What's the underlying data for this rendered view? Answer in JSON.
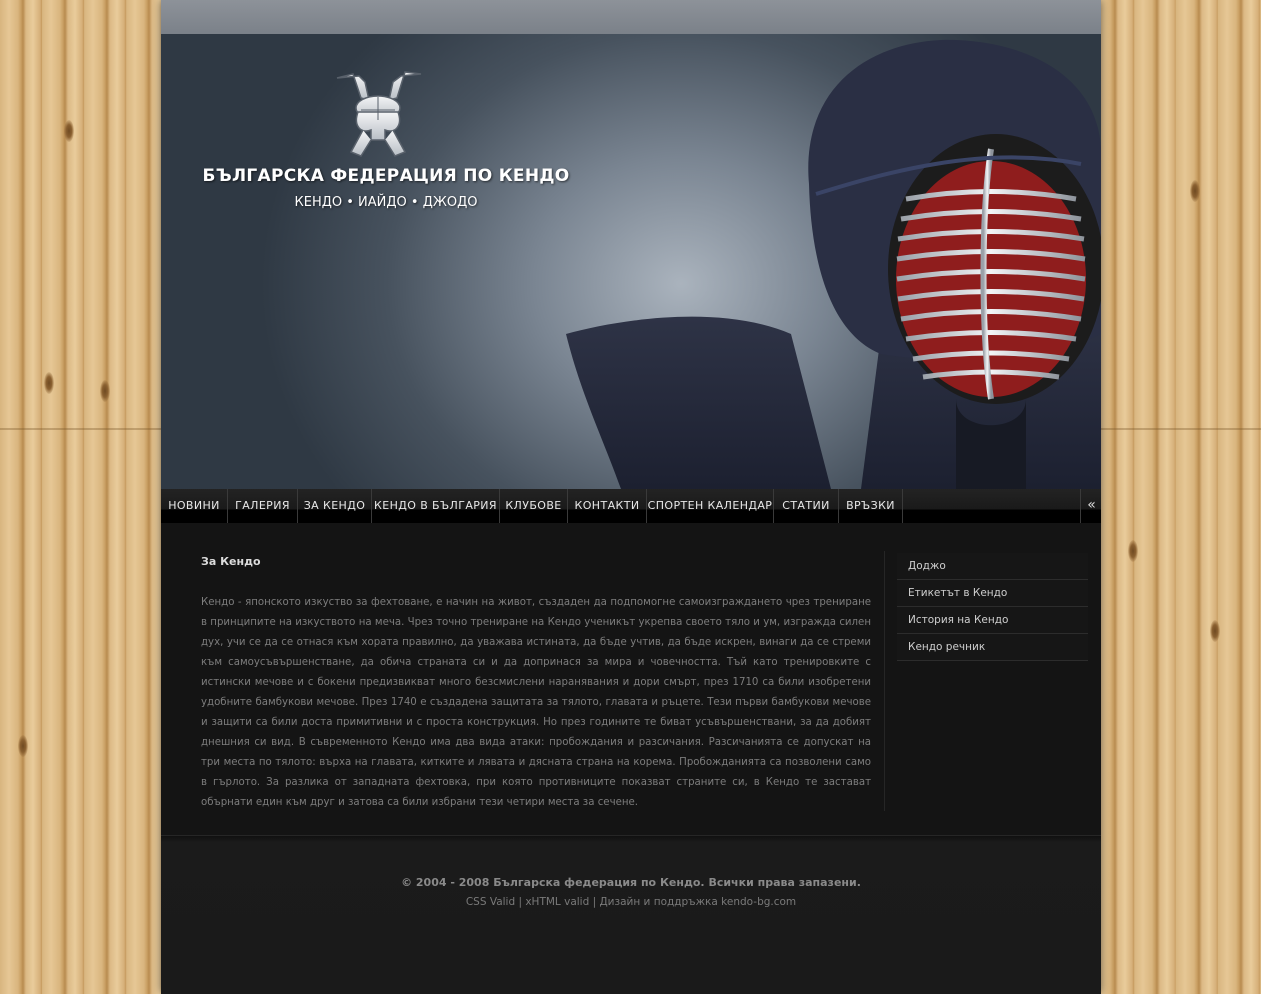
{
  "site": {
    "title": "БЪЛГАРСКА ФЕДЕРАЦИЯ ПО КЕНДО",
    "subtitle": "КЕНДО • ИАЙДО • ДЖОДО"
  },
  "nav": {
    "items": [
      {
        "label": "НОВИНИ"
      },
      {
        "label": "ГАЛЕРИЯ"
      },
      {
        "label": "ЗА КЕНДО"
      },
      {
        "label": "КЕНДО В БЪЛГАРИЯ"
      },
      {
        "label": "КЛУБОВЕ"
      },
      {
        "label": "КОНТАКТИ"
      },
      {
        "label": "СПОРТЕН КАЛЕНДАР"
      },
      {
        "label": "СТАТИИ"
      },
      {
        "label": "ВРЪЗКИ"
      }
    ],
    "collapse_icon": "«"
  },
  "article": {
    "title": "За Кендо",
    "body": "Кендо - японското изкуство за фехтоване, е начин на живот, създаден да подпомогне самоизграждането чрез трениране в принципите на изкуството на меча. Чрез точно трениране на Кендо ученикът укрепва своето тяло и ум, изгражда силен дух, учи се да се отнася към хората правилно, да уважава истината, да бъде учтив, да бъде искрен, винаги да се стреми към самоусъвършенстване, да обича страната си и да допринася за мира и човечността. Тъй като тренировките с истински мечове и с бокени предизвикват много безсмислени наранявания и дори смърт, през 1710 са били изобретени удобните бамбукови мечове. През 1740 е създадена защитата за тялото, главата и ръцете. Тези първи бамбукови мечове и защити са били доста примитивни и с проста конструкция. Но през годините те биват усъвършенствани, за да добият днешния си вид. В съвременното Кендо има два вида атаки: пробождания и разсичания. Разсичанията се допускат на три места по тялото: върха на главата, китките и лявата и дясната страна на корема. Пробожданията са позволени само в гърлото. За разлика от западната фехтовка, при която противниците показват страните си, в Кендо те застават обърнати един към друг и затова са били избрани тези четири места за сечене."
  },
  "sidebar": {
    "items": [
      {
        "label": "Доджо"
      },
      {
        "label": "Етикетът в Кендо"
      },
      {
        "label": "История на Кендо"
      },
      {
        "label": "Кендо речник"
      }
    ]
  },
  "footer": {
    "copyright": "© 2004 - 2008 Българска федерация по Кендо. Всички права запазени.",
    "links": "CSS Valid | xHTML valid | Дизайн и поддръжка kendo-bg.com"
  },
  "colors": {
    "page_bg": "#151515",
    "header_bg": "#47525e",
    "nav_bg": "#000000",
    "wood": "#d8b57f"
  }
}
